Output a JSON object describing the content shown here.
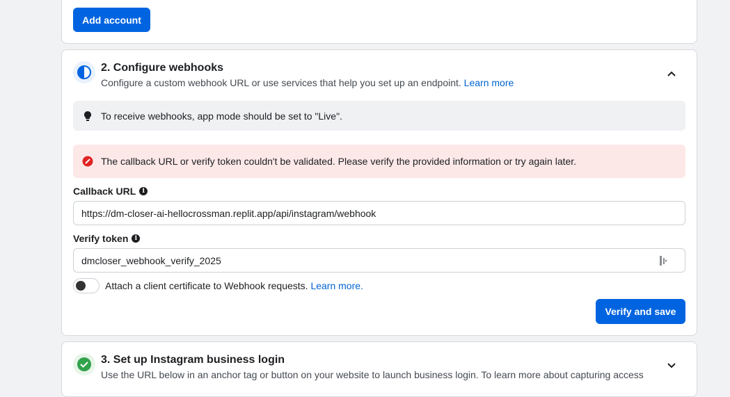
{
  "top_card": {
    "add_account_label": "Add account"
  },
  "step2": {
    "title": "2. Configure webhooks",
    "description": "Configure a custom webhook URL or use services that help you set up an endpoint.",
    "learn_more": "Learn more",
    "info_banner": "To receive webhooks, app mode should be set to \"Live\".",
    "error_banner": "The callback URL or verify token couldn't be validated. Please verify the provided information or try again later.",
    "callback_label": "Callback URL",
    "callback_value": "https://dm-closer-ai-hellocrossman.replit.app/api/instagram/webhook",
    "verify_label": "Verify token",
    "verify_value": "dmcloser_webhook_verify_2025",
    "toggle_text": "Attach a client certificate to Webhook requests.",
    "toggle_link": "Learn more.",
    "verify_save_label": "Verify and save"
  },
  "step3": {
    "title": "3. Set up Instagram business login",
    "description": "Use the URL below in an anchor tag or button on your website to launch business login. To learn more about capturing access"
  },
  "colors": {
    "primary": "#0064e0",
    "error_bg": "#fde8e8",
    "error_icon": "#e02424",
    "success": "#31a24c"
  }
}
